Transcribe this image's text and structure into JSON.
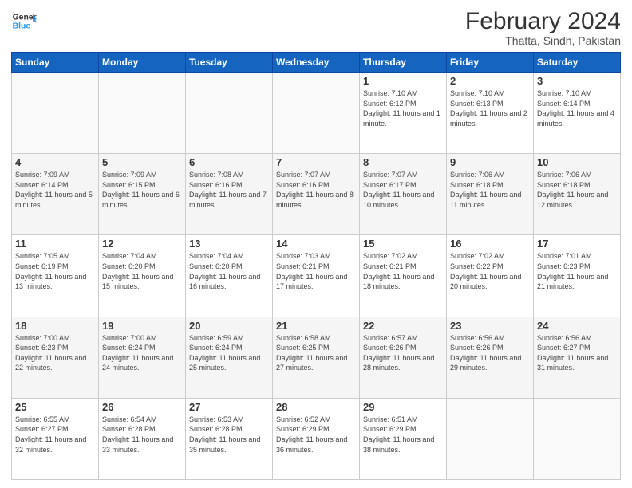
{
  "header": {
    "logo_line1": "General",
    "logo_line2": "Blue",
    "month_year": "February 2024",
    "location": "Thatta, Sindh, Pakistan"
  },
  "weekdays": [
    "Sunday",
    "Monday",
    "Tuesday",
    "Wednesday",
    "Thursday",
    "Friday",
    "Saturday"
  ],
  "weeks": [
    [
      {
        "day": "",
        "info": ""
      },
      {
        "day": "",
        "info": ""
      },
      {
        "day": "",
        "info": ""
      },
      {
        "day": "",
        "info": ""
      },
      {
        "day": "1",
        "info": "Sunrise: 7:10 AM\nSunset: 6:12 PM\nDaylight: 11 hours and 1 minute."
      },
      {
        "day": "2",
        "info": "Sunrise: 7:10 AM\nSunset: 6:13 PM\nDaylight: 11 hours and 2 minutes."
      },
      {
        "day": "3",
        "info": "Sunrise: 7:10 AM\nSunset: 6:14 PM\nDaylight: 11 hours and 4 minutes."
      }
    ],
    [
      {
        "day": "4",
        "info": "Sunrise: 7:09 AM\nSunset: 6:14 PM\nDaylight: 11 hours and 5 minutes."
      },
      {
        "day": "5",
        "info": "Sunrise: 7:09 AM\nSunset: 6:15 PM\nDaylight: 11 hours and 6 minutes."
      },
      {
        "day": "6",
        "info": "Sunrise: 7:08 AM\nSunset: 6:16 PM\nDaylight: 11 hours and 7 minutes."
      },
      {
        "day": "7",
        "info": "Sunrise: 7:07 AM\nSunset: 6:16 PM\nDaylight: 11 hours and 8 minutes."
      },
      {
        "day": "8",
        "info": "Sunrise: 7:07 AM\nSunset: 6:17 PM\nDaylight: 11 hours and 10 minutes."
      },
      {
        "day": "9",
        "info": "Sunrise: 7:06 AM\nSunset: 6:18 PM\nDaylight: 11 hours and 11 minutes."
      },
      {
        "day": "10",
        "info": "Sunrise: 7:06 AM\nSunset: 6:18 PM\nDaylight: 11 hours and 12 minutes."
      }
    ],
    [
      {
        "day": "11",
        "info": "Sunrise: 7:05 AM\nSunset: 6:19 PM\nDaylight: 11 hours and 13 minutes."
      },
      {
        "day": "12",
        "info": "Sunrise: 7:04 AM\nSunset: 6:20 PM\nDaylight: 11 hours and 15 minutes."
      },
      {
        "day": "13",
        "info": "Sunrise: 7:04 AM\nSunset: 6:20 PM\nDaylight: 11 hours and 16 minutes."
      },
      {
        "day": "14",
        "info": "Sunrise: 7:03 AM\nSunset: 6:21 PM\nDaylight: 11 hours and 17 minutes."
      },
      {
        "day": "15",
        "info": "Sunrise: 7:02 AM\nSunset: 6:21 PM\nDaylight: 11 hours and 18 minutes."
      },
      {
        "day": "16",
        "info": "Sunrise: 7:02 AM\nSunset: 6:22 PM\nDaylight: 11 hours and 20 minutes."
      },
      {
        "day": "17",
        "info": "Sunrise: 7:01 AM\nSunset: 6:23 PM\nDaylight: 11 hours and 21 minutes."
      }
    ],
    [
      {
        "day": "18",
        "info": "Sunrise: 7:00 AM\nSunset: 6:23 PM\nDaylight: 11 hours and 22 minutes."
      },
      {
        "day": "19",
        "info": "Sunrise: 7:00 AM\nSunset: 6:24 PM\nDaylight: 11 hours and 24 minutes."
      },
      {
        "day": "20",
        "info": "Sunrise: 6:59 AM\nSunset: 6:24 PM\nDaylight: 11 hours and 25 minutes."
      },
      {
        "day": "21",
        "info": "Sunrise: 6:58 AM\nSunset: 6:25 PM\nDaylight: 11 hours and 27 minutes."
      },
      {
        "day": "22",
        "info": "Sunrise: 6:57 AM\nSunset: 6:26 PM\nDaylight: 11 hours and 28 minutes."
      },
      {
        "day": "23",
        "info": "Sunrise: 6:56 AM\nSunset: 6:26 PM\nDaylight: 11 hours and 29 minutes."
      },
      {
        "day": "24",
        "info": "Sunrise: 6:56 AM\nSunset: 6:27 PM\nDaylight: 11 hours and 31 minutes."
      }
    ],
    [
      {
        "day": "25",
        "info": "Sunrise: 6:55 AM\nSunset: 6:27 PM\nDaylight: 11 hours and 32 minutes."
      },
      {
        "day": "26",
        "info": "Sunrise: 6:54 AM\nSunset: 6:28 PM\nDaylight: 11 hours and 33 minutes."
      },
      {
        "day": "27",
        "info": "Sunrise: 6:53 AM\nSunset: 6:28 PM\nDaylight: 11 hours and 35 minutes."
      },
      {
        "day": "28",
        "info": "Sunrise: 6:52 AM\nSunset: 6:29 PM\nDaylight: 11 hours and 36 minutes."
      },
      {
        "day": "29",
        "info": "Sunrise: 6:51 AM\nSunset: 6:29 PM\nDaylight: 11 hours and 38 minutes."
      },
      {
        "day": "",
        "info": ""
      },
      {
        "day": "",
        "info": ""
      }
    ]
  ]
}
